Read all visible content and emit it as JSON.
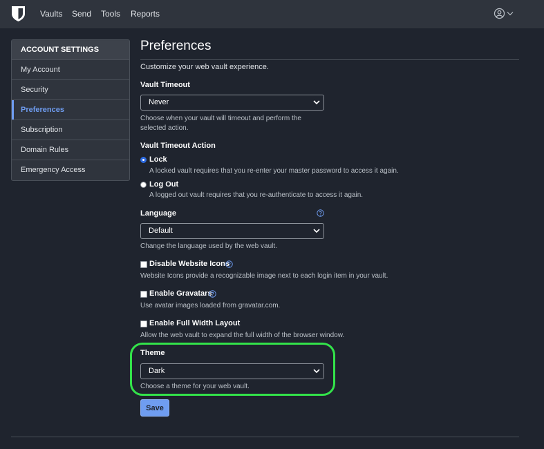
{
  "topnav": {
    "items": [
      "Vaults",
      "Send",
      "Tools",
      "Reports"
    ]
  },
  "sidebar": {
    "header": "ACCOUNT SETTINGS",
    "items": [
      {
        "label": "My Account"
      },
      {
        "label": "Security"
      },
      {
        "label": "Preferences",
        "active": true
      },
      {
        "label": "Subscription"
      },
      {
        "label": "Domain Rules"
      },
      {
        "label": "Emergency Access"
      }
    ]
  },
  "page": {
    "title": "Preferences",
    "subtitle": "Customize your web vault experience."
  },
  "vault_timeout": {
    "label": "Vault Timeout",
    "selected": "Never",
    "help_line1": "Choose when your vault will timeout and perform the",
    "help_line2": "selected action."
  },
  "timeout_action": {
    "label": "Vault Timeout Action",
    "options": [
      {
        "label": "Lock",
        "description": "A locked vault requires that you re-enter your master password to access it again.",
        "checked": true
      },
      {
        "label": "Log Out",
        "description": "A logged out vault requires that you re-authenticate to access it again.",
        "checked": false
      }
    ]
  },
  "language": {
    "label": "Language",
    "selected": "Default",
    "help": "Change the language used by the web vault."
  },
  "options": [
    {
      "label": "Disable Website Icons",
      "description": "Website Icons provide a recognizable image next to each login item in your vault.",
      "checked": false
    },
    {
      "label": "Enable Gravatars",
      "description": "Use avatar images loaded from gravatar.com.",
      "checked": false
    },
    {
      "label": "Enable Full Width Layout",
      "description": "Allow the web vault to expand the full width of the browser window.",
      "checked": false
    }
  ],
  "theme": {
    "label": "Theme",
    "selected": "Dark",
    "help": "Choose a theme for your web vault."
  },
  "save_label": "Save",
  "colors": {
    "background": "#1f242e",
    "nav": "#2f343d",
    "accent": "#6f9df1",
    "highlight": "#33e34a"
  }
}
